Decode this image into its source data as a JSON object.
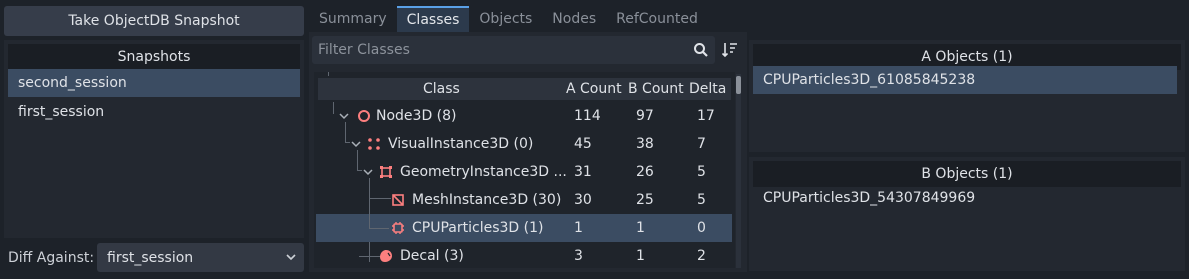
{
  "take_snapshot_label": "Take ObjectDB Snapshot",
  "snapshots": {
    "header": "Snapshots",
    "items": [
      {
        "label": "second_session",
        "selected": true
      },
      {
        "label": "first_session",
        "selected": false
      }
    ]
  },
  "diff": {
    "label": "Diff Against:",
    "selected": "first_session"
  },
  "tabs": [
    {
      "label": "Summary",
      "active": false
    },
    {
      "label": "Classes",
      "active": true
    },
    {
      "label": "Objects",
      "active": false
    },
    {
      "label": "Nodes",
      "active": false
    },
    {
      "label": "RefCounted",
      "active": false
    }
  ],
  "filter": {
    "placeholder": "Filter Classes"
  },
  "table": {
    "columns": [
      "Class",
      "A Count",
      "B Count",
      "Delta"
    ],
    "rows": [
      {
        "name": "Node3D (8)",
        "icon": "node3d-icon",
        "a": "114",
        "b": "97",
        "delta": "17",
        "selected": false
      },
      {
        "name": "VisualInstance3D (0)",
        "icon": "visualinstance3d-icon",
        "a": "45",
        "b": "38",
        "delta": "7",
        "selected": false
      },
      {
        "name": "GeometryInstance3D ...",
        "icon": "geometryinstance3d-icon",
        "a": "31",
        "b": "26",
        "delta": "5",
        "selected": false
      },
      {
        "name": "MeshInstance3D (30)",
        "icon": "meshinstance3d-icon",
        "a": "30",
        "b": "25",
        "delta": "5",
        "selected": false
      },
      {
        "name": "CPUParticles3D (1)",
        "icon": "cpuparticles3d-icon",
        "a": "1",
        "b": "1",
        "delta": "0",
        "selected": true
      },
      {
        "name": "Decal (3)",
        "icon": "decal-icon",
        "a": "3",
        "b": "1",
        "delta": "2",
        "selected": false
      }
    ]
  },
  "a_objects": {
    "header": "A Objects (1)",
    "items": [
      {
        "label": "CPUParticles3D_61085845238",
        "selected": true
      }
    ]
  },
  "b_objects": {
    "header": "B Objects (1)",
    "items": [
      {
        "label": "CPUParticles3D_54307849969",
        "selected": false
      }
    ]
  },
  "colors": {
    "accent": "#5aa0e6",
    "selection": "#3b4c62",
    "node_icon": "#fc7f7f"
  }
}
